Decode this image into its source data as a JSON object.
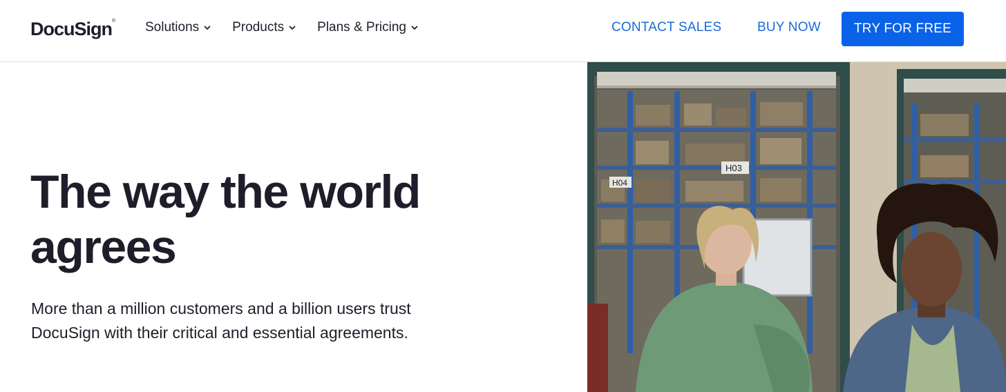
{
  "header": {
    "logo_text": "DocuSign",
    "logo_tm": "®",
    "nav": [
      {
        "label": "Solutions"
      },
      {
        "label": "Products"
      },
      {
        "label": "Plans & Pricing"
      }
    ],
    "contact_sales": "CONTACT SALES",
    "buy_now": "BUY NOW",
    "try_free": "TRY FOR FREE"
  },
  "hero": {
    "title_line1": "The way the world",
    "title_line2": "agrees",
    "subtitle_line1": "More than a million customers and a billion users trust",
    "subtitle_line2": "DocuSign with their critical and essential agreements.",
    "photo": {
      "description_icon": "two-women-warehouse-photo",
      "shelf_tags": [
        "H03",
        "H04"
      ]
    }
  },
  "colors": {
    "accent_blue": "#0a62e8",
    "link_blue": "#1a6ad8",
    "text_dark": "#1e1e2a"
  }
}
